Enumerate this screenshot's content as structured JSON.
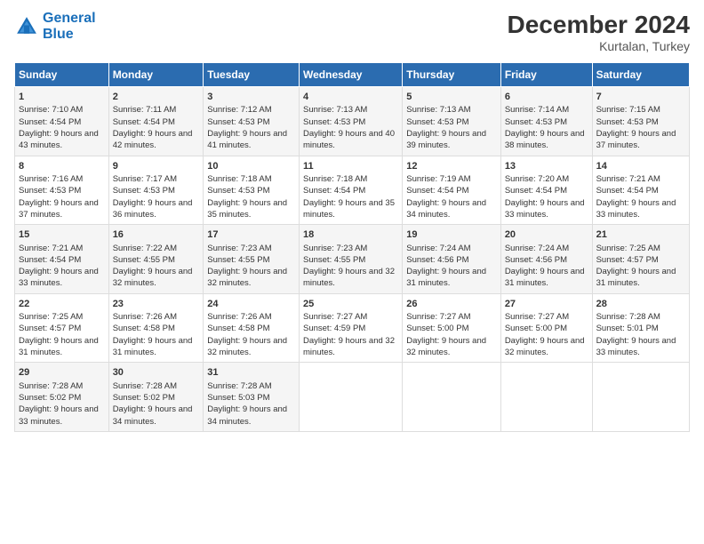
{
  "logo": {
    "line1": "General",
    "line2": "Blue"
  },
  "title": "December 2024",
  "subtitle": "Kurtalan, Turkey",
  "header_days": [
    "Sunday",
    "Monday",
    "Tuesday",
    "Wednesday",
    "Thursday",
    "Friday",
    "Saturday"
  ],
  "weeks": [
    [
      {
        "day": "1",
        "sunrise": "7:10 AM",
        "sunset": "4:54 PM",
        "daylight": "9 hours and 43 minutes."
      },
      {
        "day": "2",
        "sunrise": "7:11 AM",
        "sunset": "4:54 PM",
        "daylight": "9 hours and 42 minutes."
      },
      {
        "day": "3",
        "sunrise": "7:12 AM",
        "sunset": "4:53 PM",
        "daylight": "9 hours and 41 minutes."
      },
      {
        "day": "4",
        "sunrise": "7:13 AM",
        "sunset": "4:53 PM",
        "daylight": "9 hours and 40 minutes."
      },
      {
        "day": "5",
        "sunrise": "7:13 AM",
        "sunset": "4:53 PM",
        "daylight": "9 hours and 39 minutes."
      },
      {
        "day": "6",
        "sunrise": "7:14 AM",
        "sunset": "4:53 PM",
        "daylight": "9 hours and 38 minutes."
      },
      {
        "day": "7",
        "sunrise": "7:15 AM",
        "sunset": "4:53 PM",
        "daylight": "9 hours and 37 minutes."
      }
    ],
    [
      {
        "day": "8",
        "sunrise": "7:16 AM",
        "sunset": "4:53 PM",
        "daylight": "9 hours and 37 minutes."
      },
      {
        "day": "9",
        "sunrise": "7:17 AM",
        "sunset": "4:53 PM",
        "daylight": "9 hours and 36 minutes."
      },
      {
        "day": "10",
        "sunrise": "7:18 AM",
        "sunset": "4:53 PM",
        "daylight": "9 hours and 35 minutes."
      },
      {
        "day": "11",
        "sunrise": "7:18 AM",
        "sunset": "4:54 PM",
        "daylight": "9 hours and 35 minutes."
      },
      {
        "day": "12",
        "sunrise": "7:19 AM",
        "sunset": "4:54 PM",
        "daylight": "9 hours and 34 minutes."
      },
      {
        "day": "13",
        "sunrise": "7:20 AM",
        "sunset": "4:54 PM",
        "daylight": "9 hours and 33 minutes."
      },
      {
        "day": "14",
        "sunrise": "7:21 AM",
        "sunset": "4:54 PM",
        "daylight": "9 hours and 33 minutes."
      }
    ],
    [
      {
        "day": "15",
        "sunrise": "7:21 AM",
        "sunset": "4:54 PM",
        "daylight": "9 hours and 33 minutes."
      },
      {
        "day": "16",
        "sunrise": "7:22 AM",
        "sunset": "4:55 PM",
        "daylight": "9 hours and 32 minutes."
      },
      {
        "day": "17",
        "sunrise": "7:23 AM",
        "sunset": "4:55 PM",
        "daylight": "9 hours and 32 minutes."
      },
      {
        "day": "18",
        "sunrise": "7:23 AM",
        "sunset": "4:55 PM",
        "daylight": "9 hours and 32 minutes."
      },
      {
        "day": "19",
        "sunrise": "7:24 AM",
        "sunset": "4:56 PM",
        "daylight": "9 hours and 31 minutes."
      },
      {
        "day": "20",
        "sunrise": "7:24 AM",
        "sunset": "4:56 PM",
        "daylight": "9 hours and 31 minutes."
      },
      {
        "day": "21",
        "sunrise": "7:25 AM",
        "sunset": "4:57 PM",
        "daylight": "9 hours and 31 minutes."
      }
    ],
    [
      {
        "day": "22",
        "sunrise": "7:25 AM",
        "sunset": "4:57 PM",
        "daylight": "9 hours and 31 minutes."
      },
      {
        "day": "23",
        "sunrise": "7:26 AM",
        "sunset": "4:58 PM",
        "daylight": "9 hours and 31 minutes."
      },
      {
        "day": "24",
        "sunrise": "7:26 AM",
        "sunset": "4:58 PM",
        "daylight": "9 hours and 32 minutes."
      },
      {
        "day": "25",
        "sunrise": "7:27 AM",
        "sunset": "4:59 PM",
        "daylight": "9 hours and 32 minutes."
      },
      {
        "day": "26",
        "sunrise": "7:27 AM",
        "sunset": "5:00 PM",
        "daylight": "9 hours and 32 minutes."
      },
      {
        "day": "27",
        "sunrise": "7:27 AM",
        "sunset": "5:00 PM",
        "daylight": "9 hours and 32 minutes."
      },
      {
        "day": "28",
        "sunrise": "7:28 AM",
        "sunset": "5:01 PM",
        "daylight": "9 hours and 33 minutes."
      }
    ],
    [
      {
        "day": "29",
        "sunrise": "7:28 AM",
        "sunset": "5:02 PM",
        "daylight": "9 hours and 33 minutes."
      },
      {
        "day": "30",
        "sunrise": "7:28 AM",
        "sunset": "5:02 PM",
        "daylight": "9 hours and 34 minutes."
      },
      {
        "day": "31",
        "sunrise": "7:28 AM",
        "sunset": "5:03 PM",
        "daylight": "9 hours and 34 minutes."
      },
      null,
      null,
      null,
      null
    ]
  ]
}
